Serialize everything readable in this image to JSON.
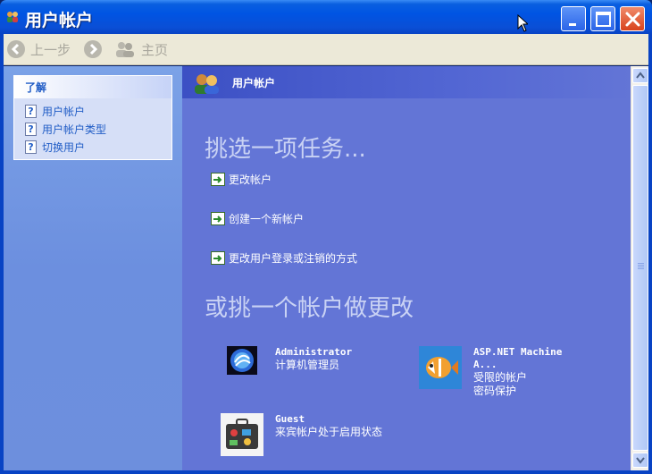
{
  "window": {
    "title": "用户帐户"
  },
  "toolbar": {
    "back_label": "上一步",
    "home_label": "主页"
  },
  "sidebar": {
    "section_title": "了解",
    "items": [
      {
        "label": "用户帐户"
      },
      {
        "label": "用户帐户类型"
      },
      {
        "label": "切换用户"
      }
    ]
  },
  "main": {
    "header_title": "用户帐户",
    "pick_task_heading": "挑选一项任务...",
    "tasks": [
      {
        "label": "更改帐户"
      },
      {
        "label": "创建一个新帐户"
      },
      {
        "label": "更改用户登录或注销的方式"
      }
    ],
    "pick_account_heading": "或挑一个帐户做更改",
    "accounts": [
      {
        "name": "Administrator",
        "line1": "计算机管理员",
        "line2": ""
      },
      {
        "name": "ASP.NET Machine",
        "name2": "A...",
        "line1": "受限的帐户",
        "line2": "密码保护"
      },
      {
        "name": "Guest",
        "line1": "来宾帐户处于启用状态",
        "line2": ""
      }
    ]
  },
  "colors": {
    "titlebar": "#0054e3",
    "main_bg": "#6375d6",
    "sidebar_bg": "#7ba2e7",
    "toolbar_bg": "#ece9d8",
    "link_blue": "#215dc6"
  }
}
